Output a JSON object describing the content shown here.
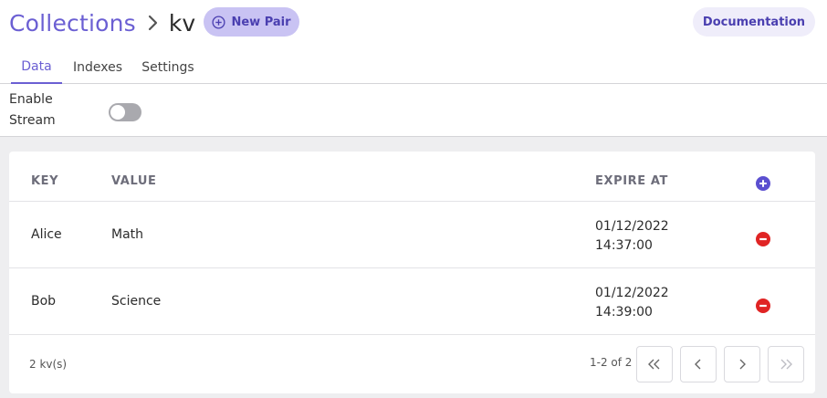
{
  "breadcrumb": {
    "root": "Collections",
    "separator_icon": "chevron-right-icon",
    "current": "kv"
  },
  "header": {
    "new_pair_label": "New Pair",
    "new_pair_icon": "plus-circle-icon",
    "docs_label": "Documentation"
  },
  "tabs": [
    {
      "label": "Data",
      "active": true
    },
    {
      "label": "Indexes",
      "active": false
    },
    {
      "label": "Settings",
      "active": false
    }
  ],
  "stream": {
    "label_line1": "Enable",
    "label_line2": "Stream",
    "enabled": false
  },
  "table": {
    "columns": [
      "KEY",
      "VALUE",
      "EXPIRE AT"
    ],
    "rows": [
      {
        "key": "Alice",
        "value": "Math",
        "expire_date": "01/12/2022",
        "expire_time": "14:37:00"
      },
      {
        "key": "Bob",
        "value": "Science",
        "expire_date": "01/12/2022",
        "expire_time": "14:39:00"
      }
    ]
  },
  "footer": {
    "count": "2 kv(s)",
    "range": "1-2 of 2"
  },
  "colors": {
    "accent": "#6b5fd3",
    "add_icon": "#5b4fd0",
    "delete_icon": "#e02424",
    "button_bg": "#c9c3f3"
  }
}
